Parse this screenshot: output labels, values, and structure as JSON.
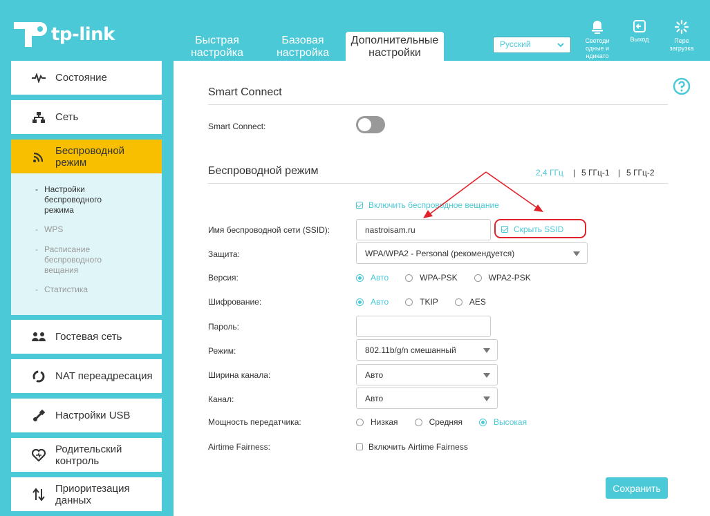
{
  "header": {
    "logo_text": "tp-link",
    "tabs": [
      {
        "label": "Быстрая настройка"
      },
      {
        "label": "Базовая настройка"
      },
      {
        "label": "Дополнительные настройки"
      }
    ],
    "language": "Русский",
    "buttons": [
      {
        "label": "Светоди одные и ндикато",
        "icon": "led-icon"
      },
      {
        "label": "Выход",
        "icon": "logout-icon"
      },
      {
        "label": "Пере загрузка",
        "icon": "reboot-icon"
      }
    ]
  },
  "sidebar": {
    "items": [
      {
        "label": "Состояние",
        "icon": "pulse-icon"
      },
      {
        "label": "Сеть",
        "icon": "network-icon"
      },
      {
        "label": "Беспроводной режим",
        "icon": "wifi-icon",
        "active": true
      },
      {
        "label": "Гостевая сеть",
        "icon": "guest-icon"
      },
      {
        "label": "NAT переадресация",
        "icon": "nat-icon"
      },
      {
        "label": "Настройки USB",
        "icon": "usb-icon"
      },
      {
        "label": "Родительский контроль",
        "icon": "heart-icon"
      },
      {
        "label": "Приоритезация данных",
        "icon": "priority-icon"
      }
    ],
    "subitems": [
      {
        "label": "Настройки беспроводного режима",
        "active": true
      },
      {
        "label": "WPS"
      },
      {
        "label": "Расписание беспроводного вещания"
      },
      {
        "label": "Статистика"
      }
    ]
  },
  "main": {
    "smart_connect": {
      "title": "Smart Connect",
      "label": "Smart Connect:",
      "enabled": false
    },
    "wireless": {
      "title": "Беспроводной режим",
      "bands": [
        "2,4 ГГц",
        "5 ГГц-1",
        "5 ГГц-2"
      ],
      "separator": "|",
      "enable_broadcast_label": "Включить беспроводное вещание",
      "ssid_label": "Имя беспроводной сети (SSID):",
      "ssid_value": "nastroisam.ru",
      "hide_ssid_label": "Скрыть SSID",
      "security_label": "Защита:",
      "security_value": "WPA/WPA2 - Personal (рекомендуется)",
      "version_label": "Версия:",
      "version_options": [
        "Авто",
        "WPA-PSK",
        "WPA2-PSK"
      ],
      "encryption_label": "Шифрование:",
      "encryption_options": [
        "Авто",
        "TKIP",
        "AES"
      ],
      "password_label": "Пароль:",
      "password_value": "",
      "mode_label": "Режим:",
      "mode_value": "802.11b/g/n смешанный",
      "width_label": "Ширина канала:",
      "width_value": "Авто",
      "channel_label": "Канал:",
      "channel_value": "Авто",
      "power_label": "Мощность передатчика:",
      "power_options": [
        "Низкая",
        "Средняя",
        "Высокая"
      ],
      "airtime_label": "Airtime Fairness:",
      "airtime_checkbox_label": "Включить Airtime Fairness"
    },
    "save_label": "Сохранить"
  },
  "colors": {
    "accent": "#4bc9d7",
    "active_nav": "#f7bf00",
    "highlight_red": "#e0232b"
  }
}
